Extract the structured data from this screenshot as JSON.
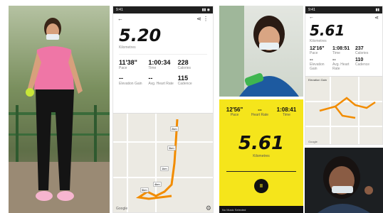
{
  "panel_a": {
    "photo_desc": "woman in pink top with face mask standing outdoors",
    "bottle_color": "#c8e638"
  },
  "panel_b": {
    "status_time": "9:41",
    "distance": "5.20",
    "distance_unit": "Kilometres",
    "stats": [
      {
        "value": "11'38\"",
        "label": "Pace"
      },
      {
        "value": "1:00:34",
        "label": "Time"
      },
      {
        "value": "228",
        "label": "Calories"
      },
      {
        "value": "--",
        "label": "Elevation Gain"
      },
      {
        "value": "-- ",
        "label": "Avg. Heart Rate"
      },
      {
        "value": "115",
        "label": "Cadence"
      }
    ],
    "map_labels": [
      "2km",
      "3km",
      "1km",
      "4km",
      "5km"
    ],
    "map_brand": "Google"
  },
  "panel_c": {
    "photo_desc": "woman in blue with face mask holding green bottle"
  },
  "panel_d": {
    "top_stats": [
      {
        "value": "12'56\"",
        "label": "Pace"
      },
      {
        "value": "--",
        "label": "Heart Rate"
      },
      {
        "value": "1:08:41",
        "label": "Time"
      }
    ],
    "distance": "5.61",
    "distance_unit": "Kilometres",
    "pause_label": "II",
    "footer_text": "No Music Selected"
  },
  "panel_e": {
    "distance": "5.61",
    "distance_unit": "Kilometres",
    "stats": [
      {
        "value": "12'16\"",
        "label": "Pace"
      },
      {
        "value": "1:08:51",
        "label": "Time"
      },
      {
        "value": "237",
        "label": "Calories"
      },
      {
        "value": "--",
        "label": "Elevation Gain"
      },
      {
        "value": "--",
        "label": "Avg. Heart Rate"
      },
      {
        "value": "110",
        "label": "Cadence"
      }
    ],
    "map_title": "Elevation Gain",
    "map_brand": "Google"
  },
  "panel_f": {
    "photo_desc": "woman with face mask outdoors at night"
  }
}
